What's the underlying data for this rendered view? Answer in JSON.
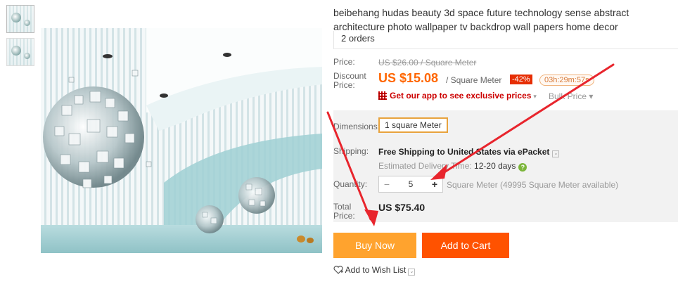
{
  "product": {
    "title": "beibehang hudas beauty 3d space future technology sense abstract architecture photo wallpaper tv backdrop wall papers home decor",
    "orders": "2 orders"
  },
  "price": {
    "label": "Price:",
    "original": "US $26.00 / Square Meter",
    "discount_label": "Discount Price:",
    "discount_price": "US $15.08",
    "unit": "/ Square Meter",
    "discount_badge": "-42%",
    "timer": "03h:29m:57s",
    "app_link": "Get our app to see exclusive prices",
    "bulk": "Bulk Price ▾",
    "app_chevron": "▾"
  },
  "dimensions": {
    "label": "Dimensions:",
    "selected": "1 square Meter"
  },
  "shipping": {
    "label": "Shipping:",
    "main": "Free Shipping to United States via ePacket",
    "est_prefix": "Estimated Delivery Time:",
    "est_days": "12-20 days",
    "chevron": "⌄",
    "help": "?"
  },
  "quantity": {
    "label": "Quantity:",
    "value": "5",
    "minus": "−",
    "plus": "+",
    "note": "Square Meter (49995 Square Meter available)"
  },
  "total": {
    "label": "Total Price:",
    "value": "US $75.40"
  },
  "actions": {
    "buy_now": "Buy Now",
    "add_to_cart": "Add to Cart",
    "wishlist": "Add to Wish List",
    "wishlist_chevron": "⌄"
  },
  "colors": {
    "arrow": "#e8252d",
    "buy": "#ffa32e",
    "cart": "#ff5200",
    "price": "#ff6600"
  },
  "icons": [
    "qr-code-icon",
    "heart-plus-icon",
    "help-icon",
    "chevron-down-icon"
  ]
}
